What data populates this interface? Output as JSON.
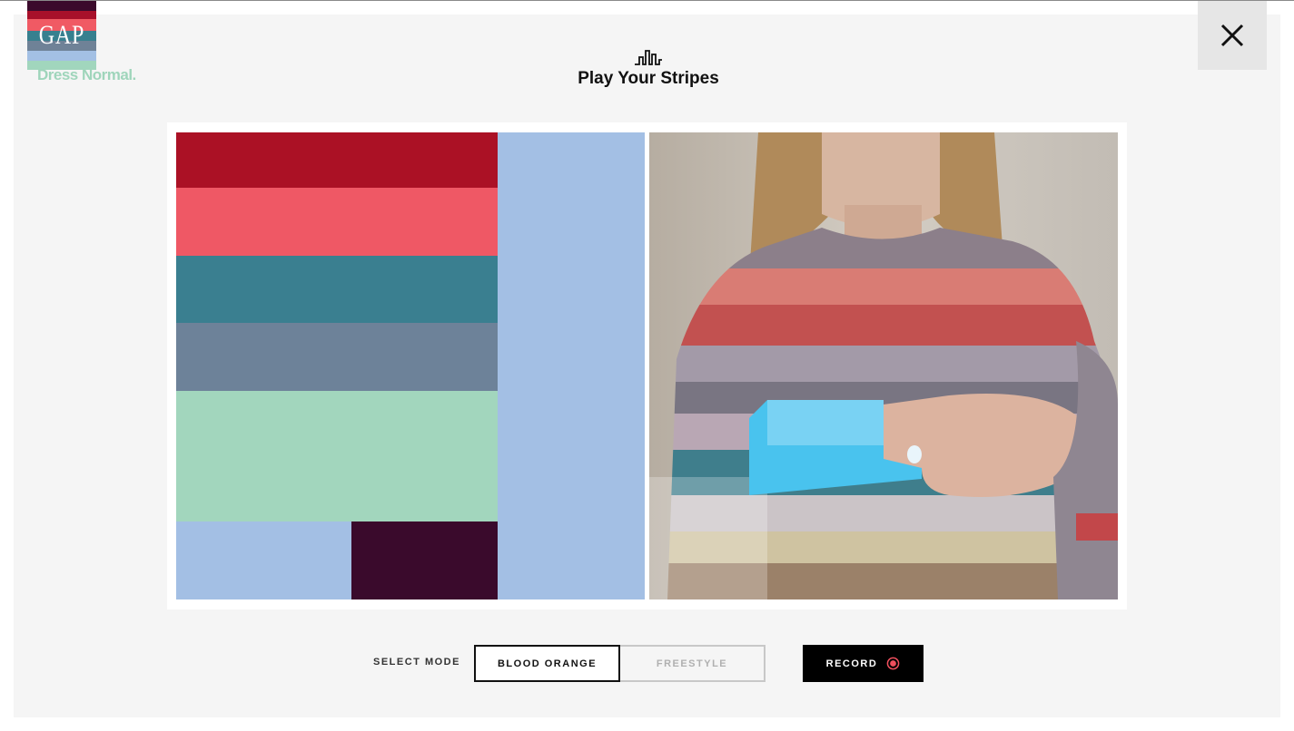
{
  "brand": {
    "logo_text": "GAP",
    "tagline": "Dress Normal.",
    "stripe_colors": [
      "#3b0a2c",
      "#a8102a",
      "#f05a64",
      "#37808f",
      "#6f8297",
      "#a3c0e4",
      "#a1d6bd"
    ]
  },
  "header": {
    "icon": "waveform-icon",
    "title": "Play Your Stripes",
    "close_icon": "close-icon"
  },
  "pattern": {
    "colors": {
      "crimson": "#ab1125",
      "coral": "#ef5865",
      "teal": "#3a7f90",
      "slate": "#6d8299",
      "mint": "#a2d6bd",
      "sky": "#a3bfe4",
      "plum": "#3a0a2c"
    }
  },
  "camera": {
    "description_icon": "webcam-feed-image"
  },
  "controls": {
    "select_mode_label": "SELECT MODE",
    "modes": [
      "BLOOD ORANGE",
      "FREESTYLE"
    ],
    "selected_mode": "BLOOD ORANGE",
    "record_label": "RECORD",
    "record_icon": "record-icon",
    "accent": "#ef4f5d"
  }
}
